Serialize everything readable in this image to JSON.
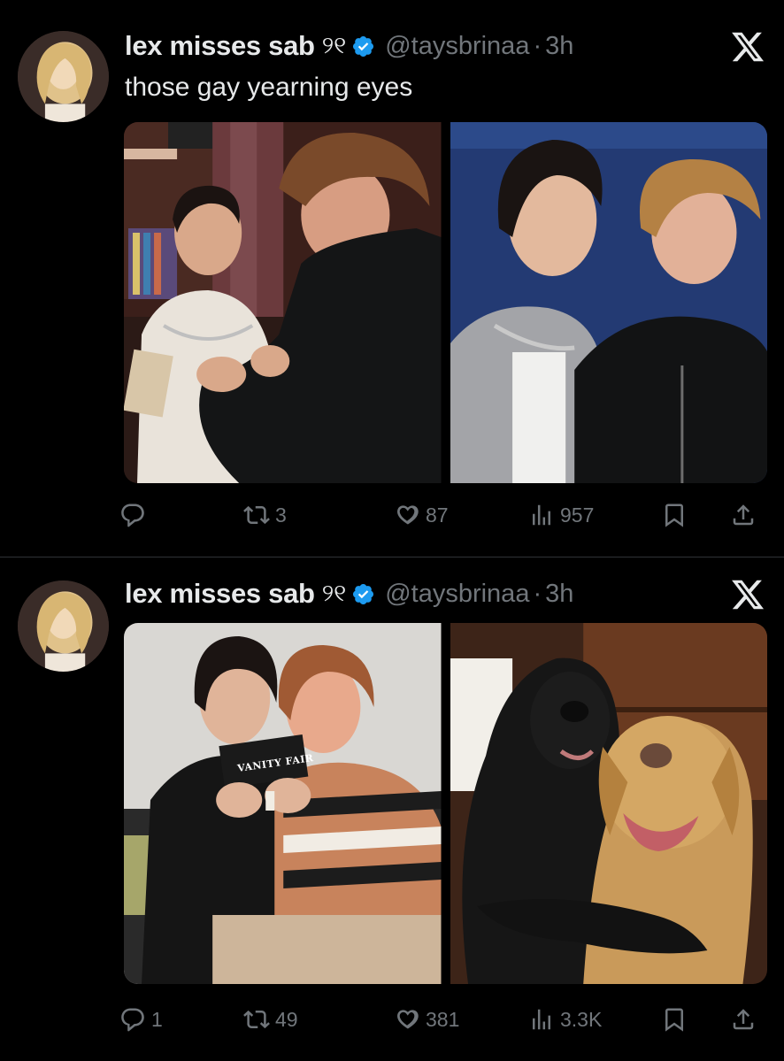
{
  "tweets": [
    {
      "author": {
        "name": "lex misses sab",
        "glyph": "୨୧",
        "handle": "@taysbrinaa",
        "time": "3h"
      },
      "text": "those gay yearning eyes",
      "stats": {
        "replies": "",
        "reposts": "3",
        "likes": "87",
        "views": "957"
      }
    },
    {
      "author": {
        "name": "lex misses sab",
        "glyph": "୨୧",
        "handle": "@taysbrinaa",
        "time": "3h"
      },
      "text": "",
      "stats": {
        "replies": "1",
        "reposts": "49",
        "likes": "381",
        "views": "3.3K"
      }
    }
  ],
  "media": {
    "tweet2_magazine_label": "VANITY FAIR"
  },
  "colors": {
    "background": "#000000",
    "text": "#e7e9ea",
    "muted": "#71767b",
    "verified": "#1d9bf0"
  },
  "icons": [
    "reply-icon",
    "repost-icon",
    "like-icon",
    "views-icon",
    "bookmark-icon",
    "share-icon",
    "x-logo-icon",
    "verified-badge-icon"
  ]
}
